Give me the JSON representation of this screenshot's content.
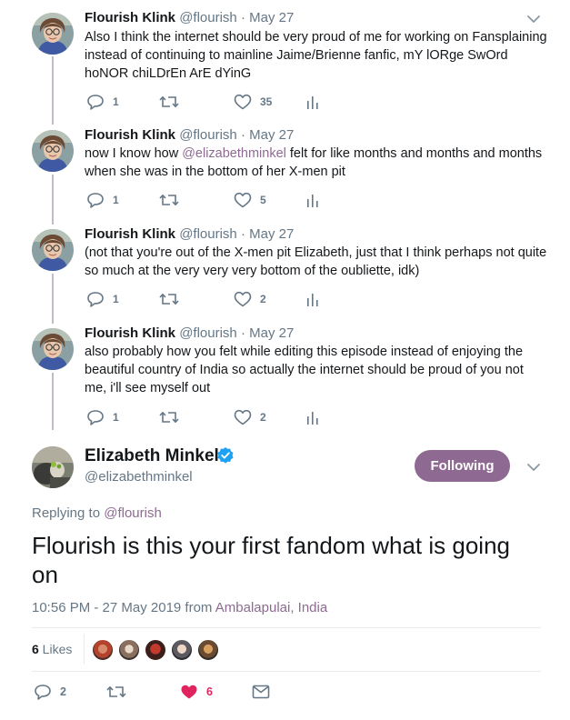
{
  "colors": {
    "accent": "#8e6a92",
    "text": "#14171a",
    "secondary": "#657786",
    "thread_line": "#c4b9c8",
    "like_active": "#e0245e",
    "verified": "#1da1f2"
  },
  "thread": [
    {
      "name": "Flourish Klink",
      "handle": "@flourish",
      "dot": "·",
      "date": "May 27",
      "text": "Also I think the internet should be very proud of me for working on Fansplaining instead of continuing to mainline Jaime/Brienne fanfic, mY lORge SwOrd hoNOR chiLDrEn ArE dYinG",
      "replies": "1",
      "retweets": "",
      "likes": "35"
    },
    {
      "name": "Flourish Klink",
      "handle": "@flourish",
      "dot": "·",
      "date": "May 27",
      "text_before": "now I know how ",
      "mention": "@elizabethminkel",
      "text_after": " felt for like months and months and months when she was in the bottom of her X-men pit",
      "replies": "1",
      "retweets": "",
      "likes": "5"
    },
    {
      "name": "Flourish Klink",
      "handle": "@flourish",
      "dot": "·",
      "date": "May 27",
      "text": "(not that you're out of the X-men pit Elizabeth, just that I think perhaps not quite so much at the very very very bottom of the oubliette, idk)",
      "replies": "1",
      "retweets": "",
      "likes": "2"
    },
    {
      "name": "Flourish Klink",
      "handle": "@flourish",
      "dot": "·",
      "date": "May 27",
      "text": "also probably how you felt while editing this episode instead of enjoying the beautiful country of India so actually the internet should be proud of you not me, i'll see myself out",
      "replies": "1",
      "retweets": "",
      "likes": "2"
    }
  ],
  "main_tweet": {
    "name": "Elizabeth Minkel",
    "handle": "@elizabethminkel",
    "follow_label": "Following",
    "replying_prefix": "Replying to ",
    "replying_to": "@flourish",
    "text": "Flourish is this your first fandom what is going on",
    "timestamp": "10:56 PM - 27 May 2019 from ",
    "location": "Ambalapulai, India",
    "likes_count": "6",
    "likes_label": " Likes",
    "replies": "2",
    "retweets": "",
    "likes": "6"
  },
  "icons": {
    "reply": "reply-icon",
    "retweet": "retweet-icon",
    "like": "heart-icon",
    "analytics": "analytics-icon",
    "dm": "envelope-icon",
    "caret": "chevron-down-icon",
    "verified": "verified-badge-icon"
  }
}
